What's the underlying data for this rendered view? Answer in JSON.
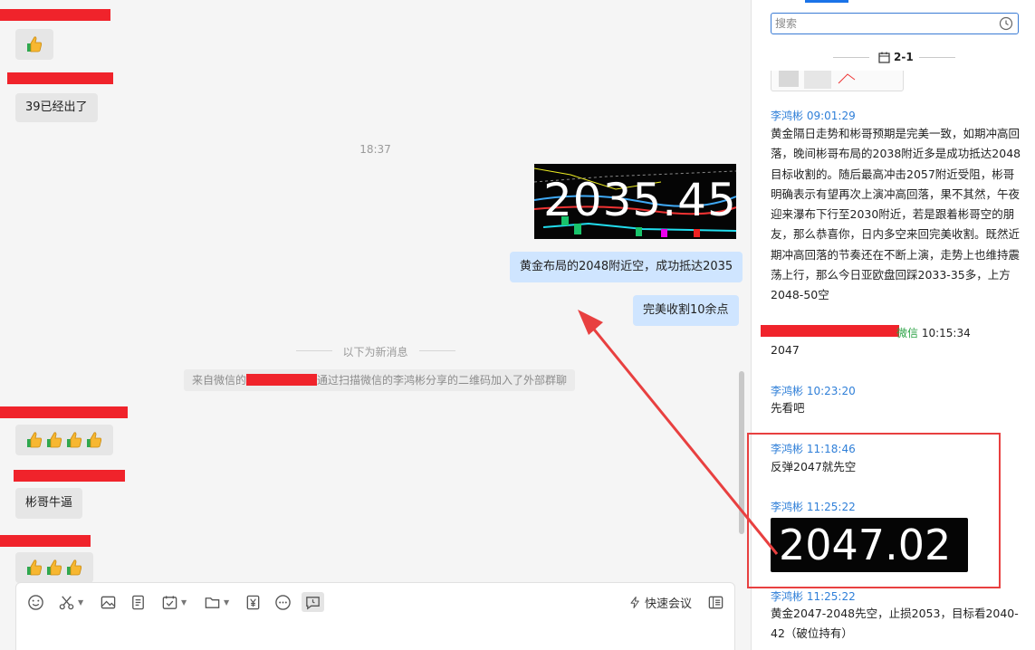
{
  "chat": {
    "messages": [
      {
        "sender_redacted": true,
        "text": ""
      },
      {
        "sender_redacted": true,
        "text": "39已经出了"
      },
      {
        "sender_redacted": true,
        "text": "彬哥牛逼"
      }
    ],
    "timestamp": "18:37",
    "image_value_1": "2035.45",
    "out_msg_1": "黄金布局的2048附近空，成功抵达2035",
    "out_msg_2": "完美收割10余点",
    "new_messages_divider": "以下为新消息",
    "system_note_prefix": "来自微信的",
    "system_note_suffix": "通过扫描微信的李鸿彬分享的二维码加入了外部群聊"
  },
  "composer": {
    "quick_meeting_label": "快速会议"
  },
  "right_panel": {
    "search_placeholder": "搜索",
    "date_separator": "2-1",
    "history": [
      {
        "header": "李鸿彬 09:01:29",
        "body": "黄金隔日走势和彬哥预期是完美一致，如期冲高回落，晚间彬哥布局的2038附近多是成功抵达2048目标收割的。随后最高冲击2057附近受阻，彬哥明确表示有望再次上演冲高回落，果不其然，午夜迎来瀑布下行至2030附近，若是跟着彬哥空的朋友，那么恭喜你，日内多空来回完美收割。既然近期冲高回落的节奏还在不断上演，走势上也维持震荡上行，那么今日亚欧盘回踩2033-35多，上方2048-50空"
      },
      {
        "header_tag": "微信",
        "header_time": "10:15:34",
        "body": "2047"
      },
      {
        "header": "李鸿彬 10:23:20",
        "body": "先看吧"
      },
      {
        "header": "李鸿彬 11:18:46",
        "body": "反弹2047就先空"
      },
      {
        "header": "李鸿彬 11:25:22",
        "image_value": "2047.02"
      },
      {
        "header": "李鸿彬 11:25:22",
        "body": "黄金2047-2048先空，止损2053，目标看2040-42（破位持有）"
      }
    ]
  },
  "colors": {
    "redaction": "#f0232b",
    "annotation": "#e84040",
    "accent": "#1a73e8",
    "outgoing_bubble": "#cfe5ff"
  }
}
